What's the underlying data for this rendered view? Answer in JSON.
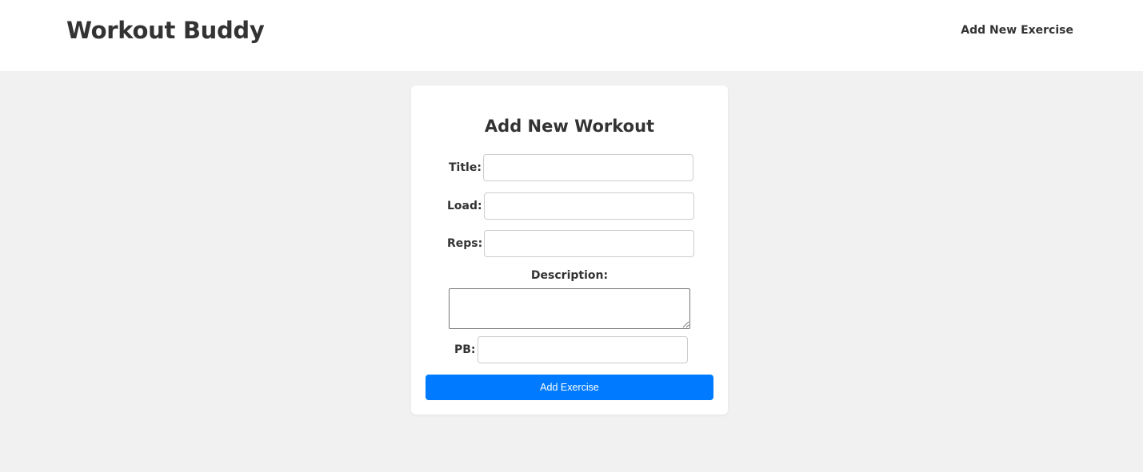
{
  "header": {
    "brand": "Workout Buddy",
    "nav_link": "Add New Exercise"
  },
  "form": {
    "title": "Add New Workout",
    "fields": {
      "title": {
        "label": "Title:",
        "value": ""
      },
      "load": {
        "label": "Load:",
        "value": ""
      },
      "reps": {
        "label": "Reps:",
        "value": ""
      },
      "description": {
        "label": "Description:",
        "value": ""
      },
      "pb": {
        "label": "PB:",
        "value": ""
      }
    },
    "submit_label": "Add Exercise"
  },
  "colors": {
    "page_background": "#f1f1f1",
    "header_background": "#ffffff",
    "card_background": "#ffffff",
    "text": "#333333",
    "primary_button": "#007bff",
    "button_text": "#ffffff"
  }
}
